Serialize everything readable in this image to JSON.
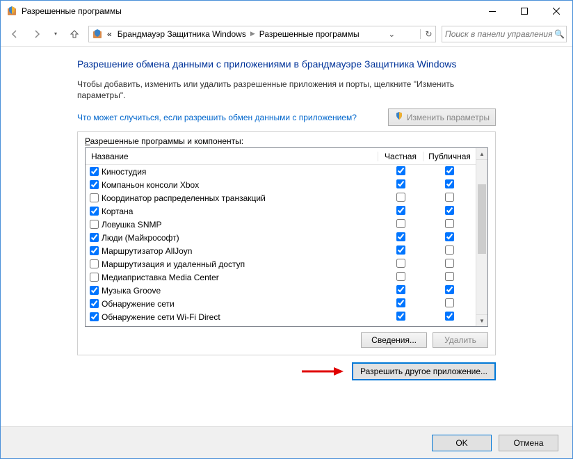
{
  "window": {
    "title": "Разрешенные программы"
  },
  "breadcrumb": {
    "prefix": "«",
    "item1": "Брандмауэр Защитника Windows",
    "item2": "Разрешенные программы"
  },
  "search": {
    "placeholder": "Поиск в панели управления"
  },
  "page": {
    "title": "Разрешение обмена данными с приложениями в брандмауэре Защитника Windows",
    "desc": "Чтобы добавить, изменить или удалить разрешенные приложения и порты, щелкните \"Изменить параметры\".",
    "help_link": "Что может случиться, если разрешить обмен данными с приложением?",
    "change_button": "Изменить параметры",
    "group_label": "Разрешенные программы и компоненты:"
  },
  "columns": {
    "name": "Название",
    "priv": "Частная",
    "pub": "Публичная"
  },
  "rows": [
    {
      "name": "Киностудия",
      "checked": true,
      "priv": true,
      "pub": true
    },
    {
      "name": "Компаньон консоли Xbox",
      "checked": true,
      "priv": true,
      "pub": true
    },
    {
      "name": "Координатор распределенных транзакций",
      "checked": false,
      "priv": false,
      "pub": false
    },
    {
      "name": "Кортана",
      "checked": true,
      "priv": true,
      "pub": true
    },
    {
      "name": "Ловушка SNMP",
      "checked": false,
      "priv": false,
      "pub": false
    },
    {
      "name": "Люди (Майкрософт)",
      "checked": true,
      "priv": true,
      "pub": true
    },
    {
      "name": "Маршрутизатор AllJoyn",
      "checked": true,
      "priv": true,
      "pub": false
    },
    {
      "name": "Маршрутизация и удаленный доступ",
      "checked": false,
      "priv": false,
      "pub": false
    },
    {
      "name": "Медиаприставка Media Center",
      "checked": false,
      "priv": false,
      "pub": false
    },
    {
      "name": "Музыка Groove",
      "checked": true,
      "priv": true,
      "pub": true
    },
    {
      "name": "Обнаружение сети",
      "checked": true,
      "priv": true,
      "pub": false
    },
    {
      "name": "Обнаружение сети Wi-Fi Direct",
      "checked": true,
      "priv": true,
      "pub": true
    }
  ],
  "buttons": {
    "details": "Сведения...",
    "remove": "Удалить",
    "allow_another": "Разрешить другое приложение...",
    "ok": "OK",
    "cancel": "Отмена"
  }
}
